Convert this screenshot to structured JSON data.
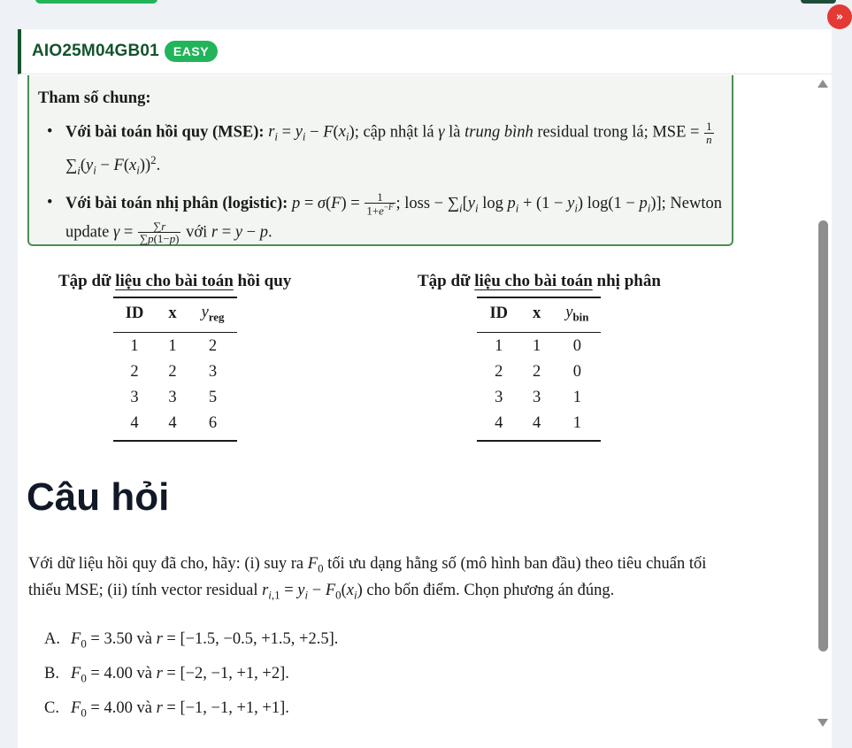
{
  "problem": {
    "code": "AIO25M04GB01",
    "difficulty": "EASY"
  },
  "params_box": {
    "title": "Tham số chung:",
    "b1_label": "Với bài toán hồi quy (MSE):",
    "b1_t1": "; cập nhật lá",
    "b1_t2": "là",
    "b1_em": "trung bình",
    "b1_t3": "residual trong lá; MSE =",
    "b2_label": "Với bài toán nhị phân (logistic):",
    "b2_t1": "; loss −",
    "b2_t2": "Newton update",
    "b2_t3": "với"
  },
  "regression_table": {
    "title_pre": "Tập dữ ",
    "title_ul": "liệu cho bài toán",
    "title_post": " hồi quy",
    "headers": [
      "ID",
      "x",
      "y_reg"
    ],
    "rows": [
      [
        "1",
        "1",
        "2"
      ],
      [
        "2",
        "2",
        "3"
      ],
      [
        "3",
        "3",
        "5"
      ],
      [
        "4",
        "4",
        "6"
      ]
    ]
  },
  "binary_table": {
    "title_pre": "Tập dữ ",
    "title_ul": "liệu cho bài toán",
    "title_post": " nhị phân",
    "headers": [
      "ID",
      "x",
      "y_bin"
    ],
    "rows": [
      [
        "1",
        "1",
        "0"
      ],
      [
        "2",
        "2",
        "0"
      ],
      [
        "3",
        "3",
        "1"
      ],
      [
        "4",
        "4",
        "1"
      ]
    ]
  },
  "question": {
    "heading": "Câu hỏi",
    "t1": "Với dữ liệu hồi quy đã cho, hãy: (i) suy ra",
    "t2": "tối ưu dạng hằng số (mô hình ban đầu) theo tiêu chuẩn tối thiểu MSE; (ii) tính vector residual",
    "t3": "cho bốn điểm. Chọn phương án đúng.",
    "options": [
      {
        "label": "A.",
        "f0": "3.50",
        "and": "và",
        "r": "[−1.5, −0.5, +1.5, +2.5]."
      },
      {
        "label": "B.",
        "f0": "4.00",
        "and": "và",
        "r": "[−2, −1, +1, +2]."
      },
      {
        "label": "C.",
        "f0": "4.00",
        "and": "và",
        "r": "[−1, −1, +1, +1]."
      }
    ]
  },
  "colors": {
    "accent": "#14532d",
    "badge": "#22b45a",
    "box_border": "#4b8f55",
    "alert": "#e53935"
  },
  "icons": [
    "chevrons-down-icon",
    "scroll-up-arrow-icon",
    "scroll-down-arrow-icon"
  ]
}
